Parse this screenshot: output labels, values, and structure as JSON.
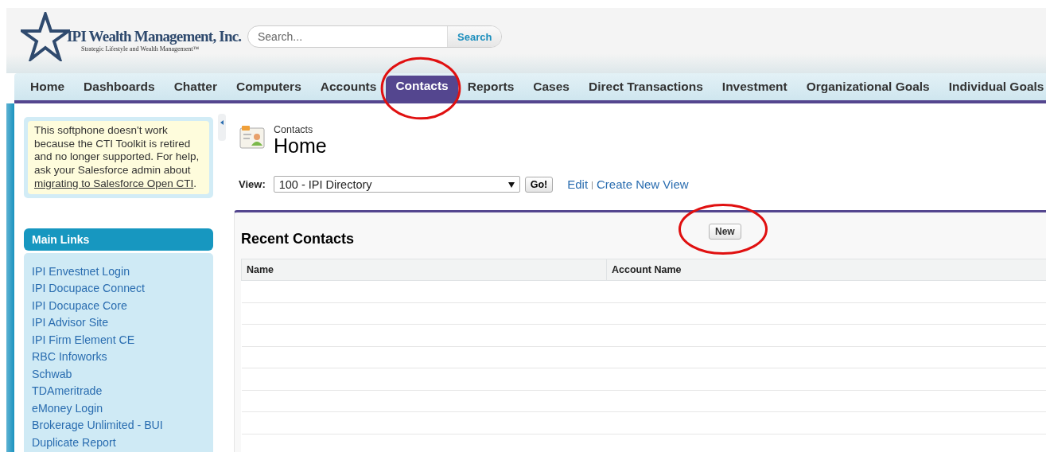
{
  "logo": {
    "name": "IPI Wealth Management, Inc.",
    "tagline": "Strategic Lifestyle and Wealth Management™"
  },
  "search": {
    "placeholder": "Search...",
    "button": "Search"
  },
  "tabs": [
    {
      "label": "Home",
      "selected": false,
      "circled": false
    },
    {
      "label": "Dashboards",
      "selected": false,
      "circled": false
    },
    {
      "label": "Chatter",
      "selected": false,
      "circled": false
    },
    {
      "label": "Computers",
      "selected": false,
      "circled": false
    },
    {
      "label": "Accounts",
      "selected": false,
      "circled": false
    },
    {
      "label": "Contacts",
      "selected": true,
      "circled": true
    },
    {
      "label": "Reports",
      "selected": false,
      "circled": false
    },
    {
      "label": "Cases",
      "selected": false,
      "circled": false
    },
    {
      "label": "Direct Transactions",
      "selected": false,
      "circled": false
    },
    {
      "label": "Investment",
      "selected": false,
      "circled": false
    },
    {
      "label": "Organizational Goals",
      "selected": false,
      "circled": false
    },
    {
      "label": "Individual Goals",
      "selected": false,
      "circled": false
    }
  ],
  "softphone_notice": {
    "text": "This softphone doesn't work because the CTI Toolkit is retired and no longer supported. For help, ask your Salesforce admin about",
    "link": "migrating to Salesforce Open CTI",
    "after": "."
  },
  "main_links": {
    "title": "Main Links",
    "items": [
      "IPI Envestnet Login",
      "IPI Docupace Connect",
      "IPI Docupace Core",
      "IPI Advisor Site",
      "IPI Firm Element CE",
      "RBC Infoworks",
      "Schwab",
      "TDAmeritrade",
      "eMoney Login",
      "Brokerage Unlimited - BUI",
      "Duplicate Report"
    ]
  },
  "page": {
    "object": "Contacts",
    "title": "Home"
  },
  "view": {
    "label": "View:",
    "value": "100 - IPI Directory",
    "go": "Go!",
    "edit": "Edit",
    "separator": "|",
    "create": "Create New View"
  },
  "recent": {
    "title": "Recent Contacts",
    "new_button": {
      "label": "New",
      "circled": true
    },
    "columns": [
      "Name",
      "Account Name"
    ]
  }
}
